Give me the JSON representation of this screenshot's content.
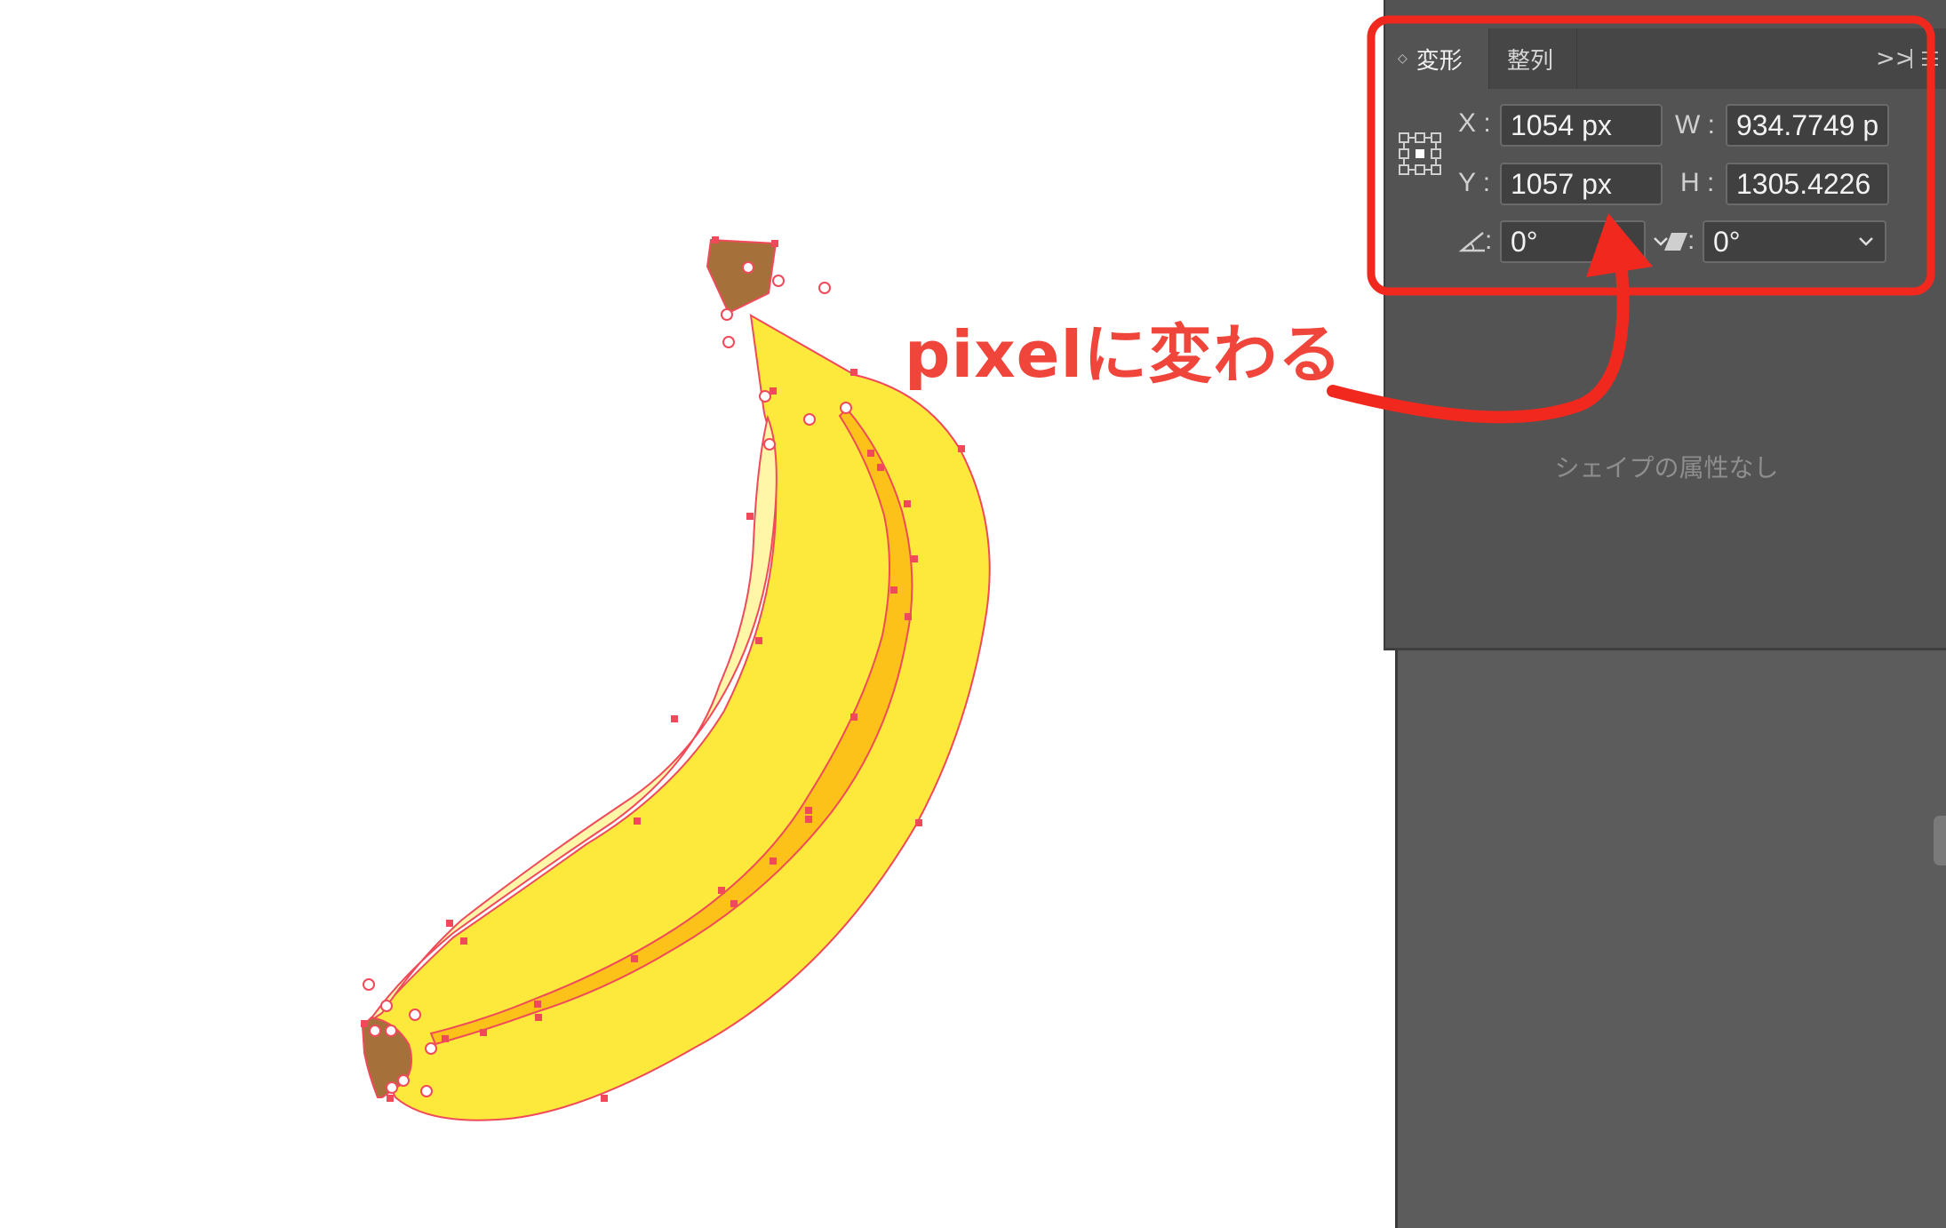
{
  "panel": {
    "tabs": [
      {
        "label": "変形",
        "active": true
      },
      {
        "label": "整列",
        "active": false
      }
    ],
    "expand_glyph": ">>",
    "x_label": "X :",
    "y_label": "Y :",
    "w_label": "W :",
    "h_label": "H :",
    "x_value": "1054 px",
    "y_value": "1057 px",
    "w_value": "934.7749 p",
    "h_value": "1305.4226",
    "rotate_label": ":",
    "rotate_value": "0°",
    "shear_label": ":",
    "shear_value": "0°",
    "no_shape_text": "シェイプの属性なし"
  },
  "annotation": {
    "text": "pixelに変わる",
    "color": "#f0453a"
  },
  "colors": {
    "banana_body": "#fde93c",
    "banana_highlight": "#fff6a8",
    "banana_stripe": "#fcc21a",
    "banana_stem": "#a6703a",
    "selection": "#f04a5a",
    "highlight_box": "#f0281e",
    "panel_bg": "#535353"
  },
  "icons": [
    "reference-point-icon",
    "rotate-icon",
    "shear-icon",
    "chevron-down-icon",
    "panel-menu-icon",
    "collapse-icon"
  ]
}
